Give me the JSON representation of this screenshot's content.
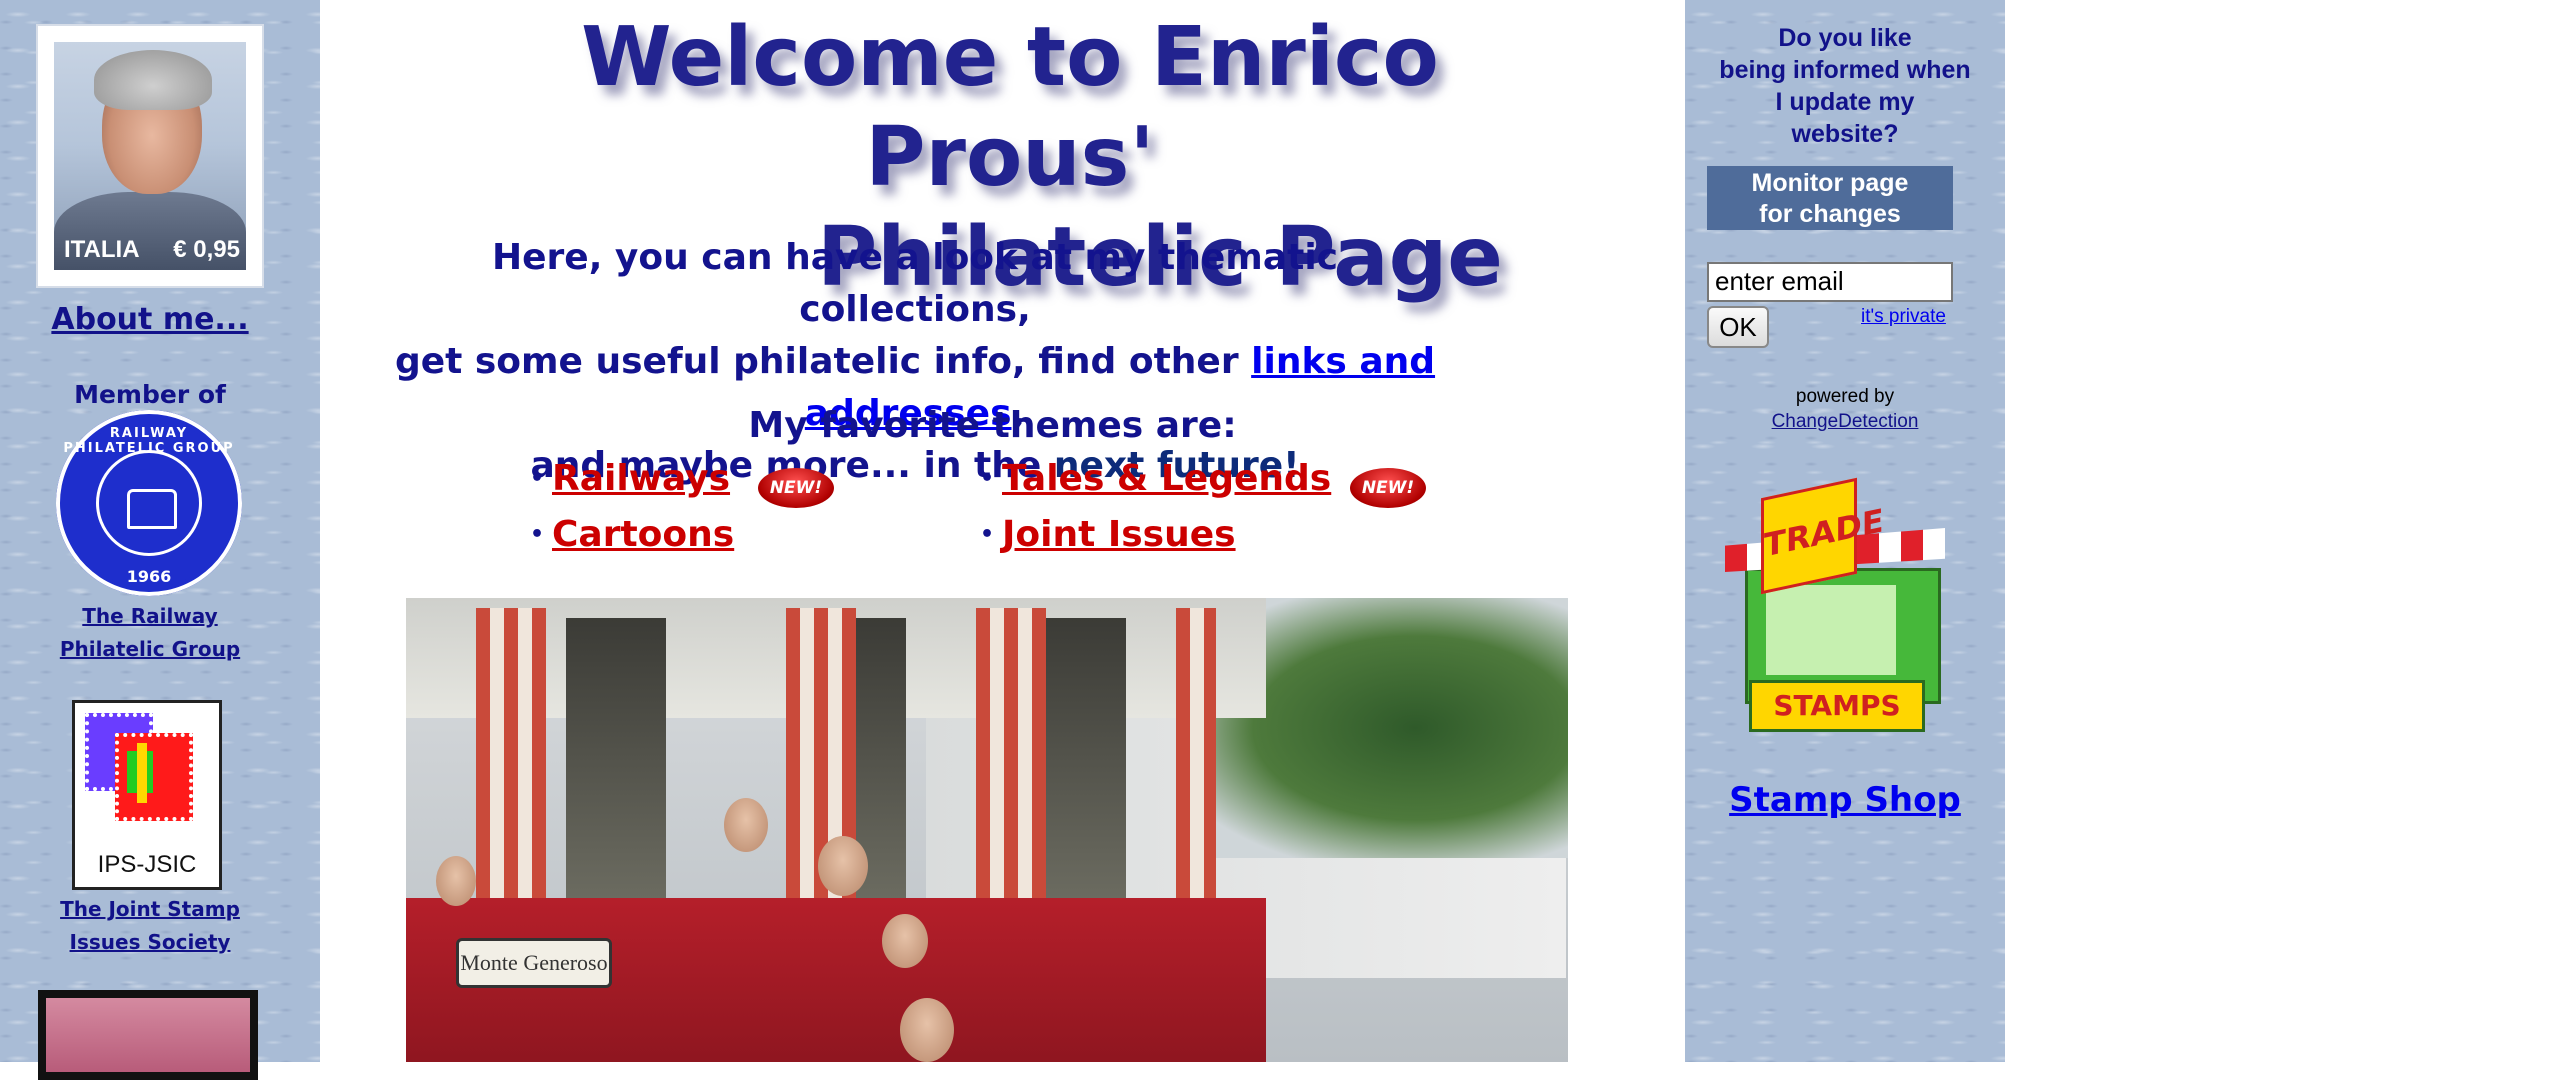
{
  "left": {
    "portrait_stamp": {
      "country": "ITALIA",
      "value": "€ 0,95"
    },
    "about_link": "About me...",
    "member_label": "Member of",
    "rpg_logo": {
      "ring_text": "RAILWAY PHILATELIC GROUP",
      "year": "1966"
    },
    "rpg_link_line1": "The Railway",
    "rpg_link_line2": "Philatelic Group",
    "ips_logo_text": "IPS-JSIC",
    "ips_link_line1": "The Joint Stamp",
    "ips_link_line2": "Issues Society"
  },
  "center": {
    "title_line1": "Welcome to Enrico Prous'",
    "title_line2": "Philatelic Page",
    "intro_line1": "Here, you can have a look at my thematic collections,",
    "intro_line2_pre": "get some useful philatelic info, find other ",
    "intro_line2_link": "links and addresses",
    "intro_line2_post": ",",
    "intro_line3_a": "and maybe more... in the ",
    "intro_line3_b": "next future!",
    "favorite_label": "My favorite themes are:",
    "themes": [
      {
        "label": "Railways",
        "new": true
      },
      {
        "label": "Tales & Legends",
        "new": true
      },
      {
        "label": "Cartoons",
        "new": false
      },
      {
        "label": "Joint Issues",
        "new": false
      }
    ],
    "new_badge": "NEW!",
    "photo_sign": "Monte Generoso"
  },
  "right": {
    "notify_line1": "Do you like",
    "notify_line2": "being informed when",
    "notify_line3": "I update my",
    "notify_line4": "website?",
    "monitor_line1": "Monitor page",
    "monitor_line2": "for changes",
    "email_placeholder": "enter email",
    "ok_label": "OK",
    "private_link": "it's private",
    "powered_by": "powered by",
    "change_detection": "ChangeDetection",
    "trade_sign": "TRADE",
    "stamps_sign": "STAMPS",
    "stamp_shop": "Stamp Shop"
  },
  "colors": {
    "side_bg": "#a9bcd6",
    "title": "#22238f",
    "theme_link": "#cc0000",
    "link": "#0000ee",
    "monitor_bg": "#4f6c9a"
  }
}
